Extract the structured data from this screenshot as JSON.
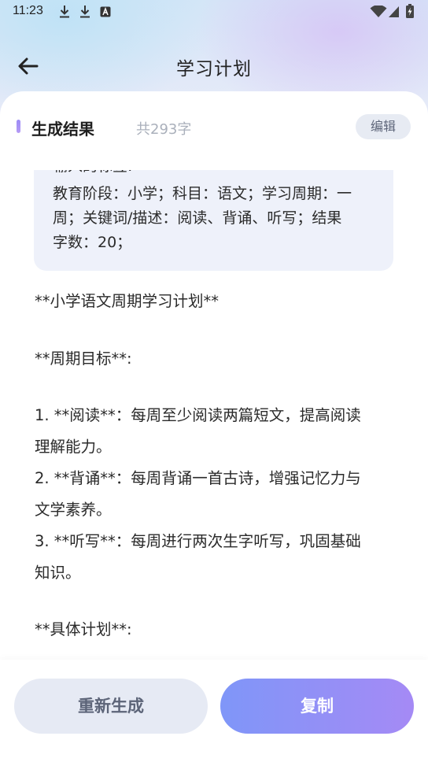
{
  "status_bar": {
    "time": "11:23",
    "left_icons": [
      "download-icon",
      "download-icon",
      "text-app-icon"
    ],
    "right_icons": [
      "wifi-icon",
      "signal-icon",
      "battery-charging-icon"
    ]
  },
  "header": {
    "title": "学习计划",
    "back_icon": "back-arrow-icon"
  },
  "result": {
    "title": "生成结果",
    "count": "共293字",
    "edit_label": "编辑",
    "accent": "#9c8cf6"
  },
  "input_box": {
    "lines": [
      "输入的标签:",
      "教育阶段：小学；科目：语文；学习周期：一",
      "周；关键词/描述：阅读、背诵、听写；结果",
      "字数：20；"
    ]
  },
  "content": {
    "lines": [
      "**小学语文周期学习计划**",
      "**周期目标**:",
      "1. **阅读**：每周至少阅读两篇短文，提高阅读",
      "理解能力。",
      "2. **背诵**：每周背诵一首古诗，增强记忆力与",
      "文学素养。",
      "3. **听写**：每周进行两次生字听写，巩固基础",
      "知识。",
      "**具体计划**:"
    ]
  },
  "buttons": {
    "regenerate": "重新生成",
    "copy": "复制"
  }
}
